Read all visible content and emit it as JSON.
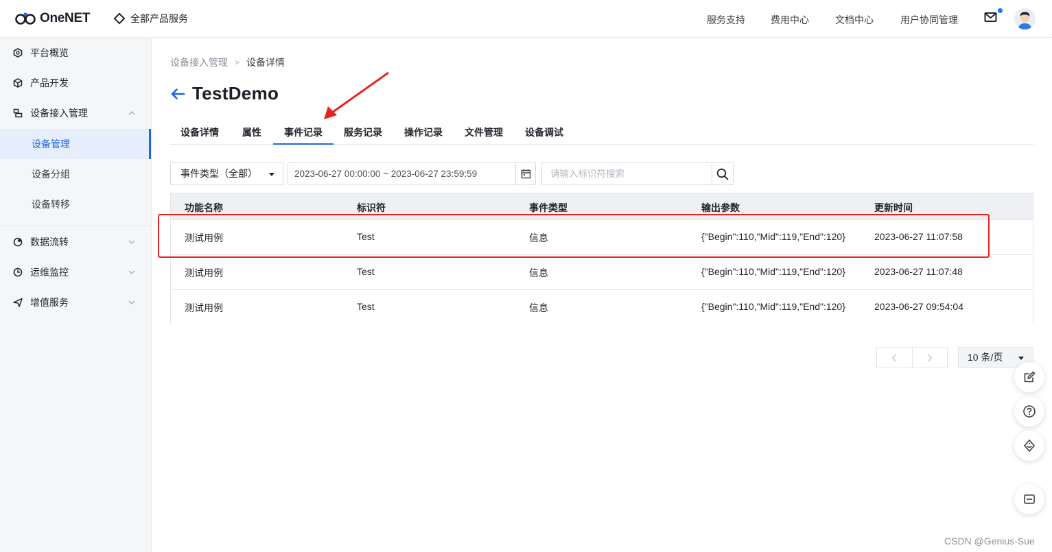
{
  "header": {
    "logo_text": "OneNET",
    "all_products": "全部产品服务",
    "nav": [
      "服务支持",
      "费用中心",
      "文档中心",
      "用户协同管理"
    ],
    "brand_color": "#1f66e0",
    "icons": [
      "mail-icon",
      "avatar"
    ]
  },
  "sidebar": {
    "items": [
      {
        "label": "平台概览",
        "icon": "overview-icon"
      },
      {
        "label": "产品开发",
        "icon": "product-icon"
      },
      {
        "label": "设备接入管理",
        "icon": "device-access-icon",
        "expanded": true
      },
      {
        "label": "数据流转",
        "icon": "data-flow-icon"
      },
      {
        "label": "运维监控",
        "icon": "monitor-icon"
      },
      {
        "label": "增值服务",
        "icon": "value-added-icon"
      }
    ],
    "sub_items": [
      {
        "label": "设备管理",
        "active": true
      },
      {
        "label": "设备分组"
      },
      {
        "label": "设备转移"
      }
    ]
  },
  "breadcrumb": {
    "parent": "设备接入管理",
    "separator": ">",
    "current": "设备详情"
  },
  "page_title": "TestDemo",
  "tabs": [
    {
      "label": "设备详情"
    },
    {
      "label": "属性"
    },
    {
      "label": "事件记录",
      "active": true
    },
    {
      "label": "服务记录"
    },
    {
      "label": "操作记录"
    },
    {
      "label": "文件管理"
    },
    {
      "label": "设备调试"
    }
  ],
  "filters": {
    "event_type": "事件类型（全部）",
    "date_range": "2023-06-27 00:00:00 ~ 2023-06-27 23:59:59",
    "search_placeholder": "请输入标识符搜索"
  },
  "table": {
    "columns": [
      "功能名称",
      "标识符",
      "事件类型",
      "输出参数",
      "更新时间"
    ],
    "rows": [
      [
        "测试用例",
        "Test",
        "信息",
        "{\"Begin\":110,\"Mid\":119,\"End\":120}",
        "2023-06-27 11:07:58"
      ],
      [
        "测试用例",
        "Test",
        "信息",
        "{\"Begin\":110,\"Mid\":119,\"End\":120}",
        "2023-06-27 11:07:48"
      ],
      [
        "测试用例",
        "Test",
        "信息",
        "{\"Begin\":110,\"Mid\":119,\"End\":120}",
        "2023-06-27 09:54:04"
      ]
    ],
    "highlighted_row": 0,
    "highlight_color": "#e8231f"
  },
  "pagination": {
    "page_size": "10 条/页"
  },
  "float_tools": [
    "edit-icon",
    "help-icon",
    "support-icon",
    "collapse-icon"
  ],
  "watermark": "CSDN @Genius-Sue"
}
